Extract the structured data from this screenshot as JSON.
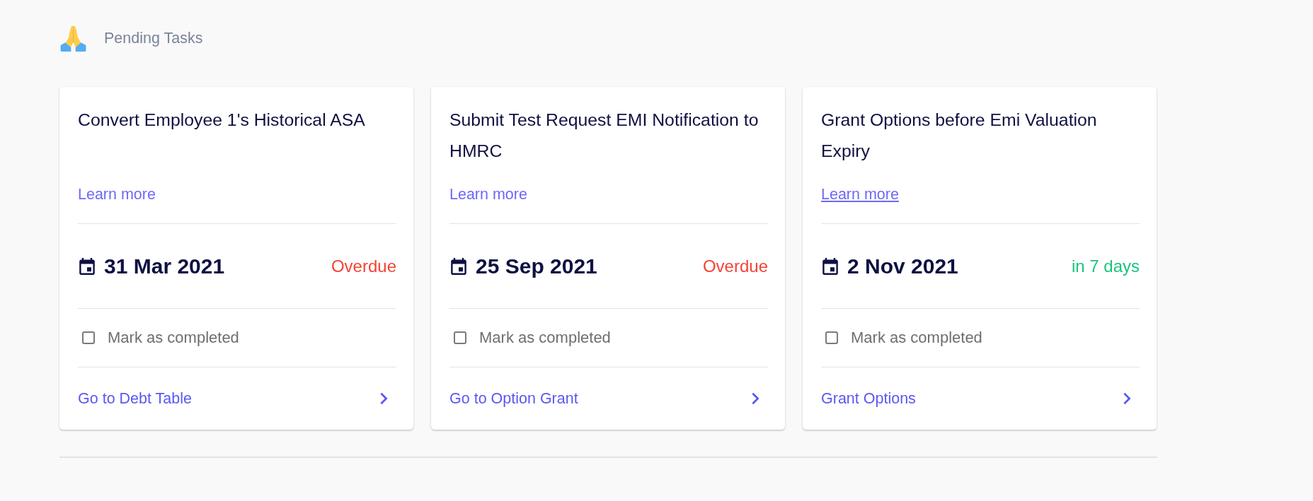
{
  "header": {
    "title": "Pending Tasks"
  },
  "tasks": [
    {
      "title": "Convert Employee 1's Historical ASA",
      "learn_more": {
        "label": "Learn more",
        "hovered": false
      },
      "due_date": "31 Mar 2021",
      "due_status": {
        "label": "Overdue",
        "color": "#f44336"
      },
      "complete": {
        "label": "Mark as completed",
        "checked": false
      },
      "action": {
        "label": "Go to Debt Table"
      }
    },
    {
      "title": "Submit Test Request EMI Notification to HMRC",
      "learn_more": {
        "label": "Learn more",
        "hovered": false
      },
      "due_date": "25 Sep 2021",
      "due_status": {
        "label": "Overdue",
        "color": "#f44336"
      },
      "complete": {
        "label": "Mark as completed",
        "checked": false
      },
      "action": {
        "label": "Go to Option Grant"
      }
    },
    {
      "title": "Grant Options before Emi Valuation Expiry",
      "learn_more": {
        "label": "Learn more",
        "hovered": true
      },
      "due_date": "2 Nov 2021",
      "due_status": {
        "label": "in 7 days",
        "color": "#1bc47d"
      },
      "complete": {
        "label": "Mark as completed",
        "checked": false
      },
      "action": {
        "label": "Grant Options"
      }
    }
  ]
}
